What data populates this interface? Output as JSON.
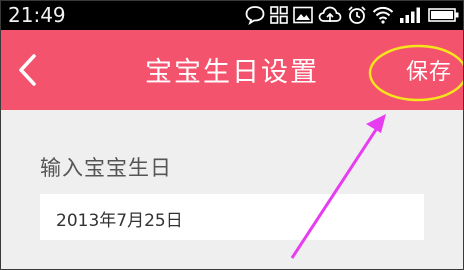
{
  "status_bar": {
    "time": "21:49",
    "icons": [
      "chat-bubble-icon",
      "app-grid-icon",
      "gallery-icon",
      "cloud-sync-icon",
      "alarm-icon",
      "wifi-icon",
      "signal-icon",
      "battery-icon"
    ]
  },
  "header": {
    "title": "宝宝生日设置",
    "save_label": "保存",
    "back_icon": "chevron-left-icon"
  },
  "form": {
    "label": "输入宝宝生日",
    "date_value": "2013年7月25日"
  },
  "colors": {
    "header_bg": "#f4536e",
    "content_bg": "#efefef",
    "highlight": "#f5e51b",
    "arrow": "#e83cf0"
  }
}
